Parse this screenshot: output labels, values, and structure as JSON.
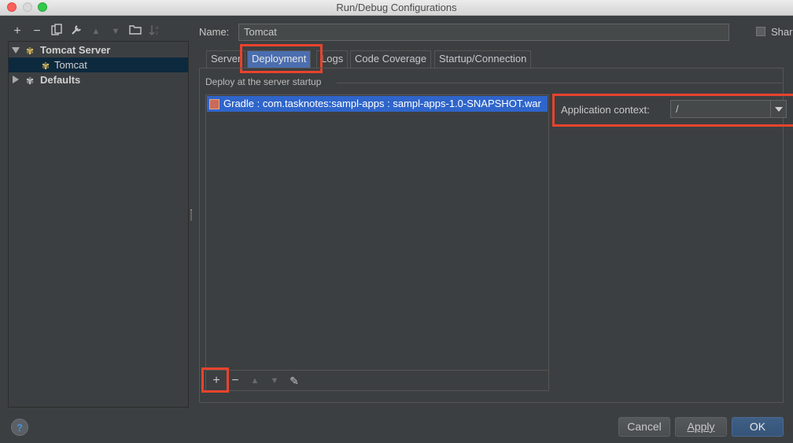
{
  "window": {
    "title": "Run/Debug Configurations"
  },
  "left_toolbar": {
    "add": "+",
    "remove": "−",
    "copy_icon": "copy-icon",
    "settings_icon": "wrench-icon",
    "move_up": "▲",
    "move_down": "▼",
    "folder_icon": "folder-icon",
    "sort_icon": "sort-alpha-icon"
  },
  "tree": {
    "items": [
      {
        "label": "Tomcat Server",
        "expanded": true,
        "bold": true
      },
      {
        "label": "Tomcat",
        "selected": true
      },
      {
        "label": "Defaults",
        "expanded": false,
        "bold": true
      }
    ]
  },
  "form": {
    "name_label": "Name:",
    "name_value": "Tomcat",
    "share_label": "Share"
  },
  "tabs": [
    {
      "label": "Server"
    },
    {
      "label": "Deployment",
      "active": true
    },
    {
      "label": "Logs"
    },
    {
      "label": "Code Coverage"
    },
    {
      "label": "Startup/Connection"
    }
  ],
  "deployment": {
    "group_label": "Deploy at the server startup",
    "artifacts": [
      {
        "label": "Gradle : com.tasknotes:sampl-apps : sampl-apps-1.0-SNAPSHOT.war",
        "selected": true
      }
    ],
    "list_toolbar": {
      "add": "+",
      "remove": "−",
      "up": "▲",
      "down": "▼",
      "edit": "✎"
    },
    "context_label": "Application context:",
    "context_value": "/"
  },
  "footer": {
    "help": "?",
    "cancel": "Cancel",
    "apply": "Apply",
    "ok": "OK"
  },
  "colors": {
    "background": "#3c3f41",
    "selection": "#2f65ca",
    "highlight": "#e8432d",
    "active_tab": "#4b6eaf"
  }
}
